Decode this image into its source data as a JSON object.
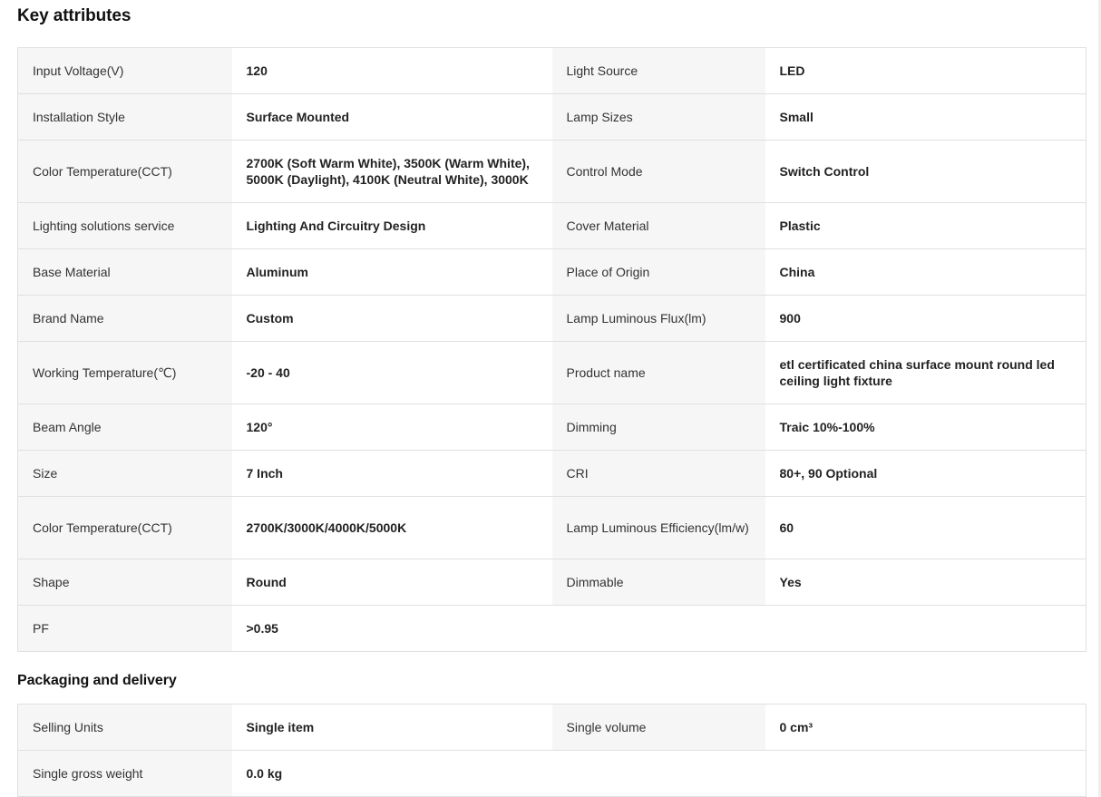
{
  "key_attributes": {
    "title": "Key attributes",
    "rows": [
      {
        "k1": "Input Voltage(V)",
        "v1": "120",
        "k2": "Light Source",
        "v2": "LED"
      },
      {
        "k1": "Installation Style",
        "v1": "Surface Mounted",
        "k2": "Lamp Sizes",
        "v2": "Small"
      },
      {
        "k1": "Color Temperature(CCT)",
        "v1": "2700K (Soft Warm White), 3500K (Warm White), 5000K (Daylight), 4100K (Neutral White), 3000K",
        "k2": "Control Mode",
        "v2": "Switch Control"
      },
      {
        "k1": "Lighting solutions service",
        "v1": "Lighting And Circuitry Design",
        "k2": "Cover Material",
        "v2": "Plastic"
      },
      {
        "k1": "Base Material",
        "v1": "Aluminum",
        "k2": "Place of Origin",
        "v2": "China"
      },
      {
        "k1": "Brand Name",
        "v1": "Custom",
        "k2": "Lamp Luminous Flux(lm)",
        "v2": "900"
      },
      {
        "k1": "Working Temperature(℃)",
        "v1": "-20 - 40",
        "k2": "Product name",
        "v2": "etl certificated china surface mount round led ceiling light fixture"
      },
      {
        "k1": "Beam Angle",
        "v1": "120°",
        "k2": "Dimming",
        "v2": "Traic 10%-100%"
      },
      {
        "k1": "Size",
        "v1": "7 Inch",
        "k2": "CRI",
        "v2": "80+, 90 Optional"
      },
      {
        "k1": "Color Temperature(CCT)",
        "v1": "2700K/3000K/4000K/5000K",
        "k2": "Lamp Luminous Efficiency(lm/w)",
        "v2": "60"
      },
      {
        "k1": "Shape",
        "v1": "Round",
        "k2": "Dimmable",
        "v2": "Yes"
      },
      {
        "k1": "PF",
        "v1": ">0.95"
      }
    ]
  },
  "packaging": {
    "title": "Packaging and delivery",
    "rows": [
      {
        "k1": "Selling Units",
        "v1": "Single item",
        "k2": "Single volume",
        "v2": "0 cm³"
      },
      {
        "k1": "Single gross weight",
        "v1": "0.0 kg"
      }
    ]
  }
}
